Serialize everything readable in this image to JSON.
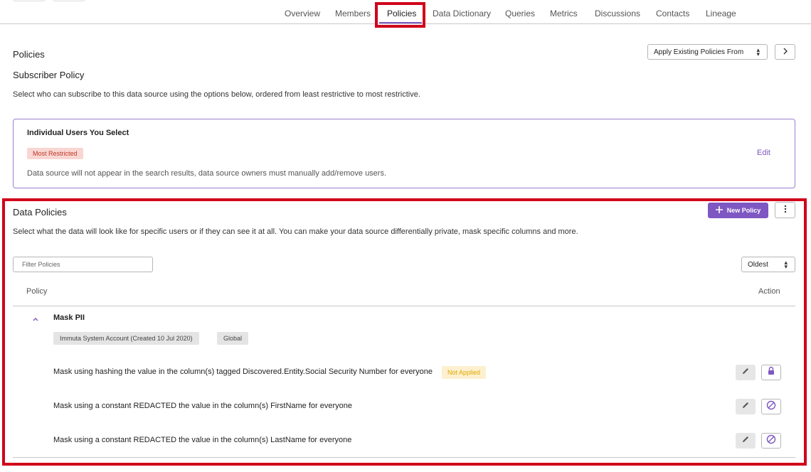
{
  "nav": {
    "tabs": [
      {
        "label": "Overview"
      },
      {
        "label": "Members"
      },
      {
        "label": "Policies"
      },
      {
        "label": "Data Dictionary"
      },
      {
        "label": "Queries"
      },
      {
        "label": "Metrics"
      },
      {
        "label": "Discussions"
      },
      {
        "label": "Contacts"
      },
      {
        "label": "Lineage"
      }
    ],
    "active_tab": "Policies"
  },
  "policies": {
    "title": "Policies",
    "apply_existing_label": "Apply Existing Policies From"
  },
  "subscriber_policy": {
    "title": "Subscriber Policy",
    "description": "Select who can subscribe to this data source using the options below, ordered from least restrictive to most restrictive.",
    "card": {
      "title": "Individual Users You Select",
      "badge": "Most Restricted",
      "edit_label": "Edit",
      "note": "Data source will not appear in the search results, data source owners must manually add/remove users."
    }
  },
  "data_policies": {
    "title": "Data Policies",
    "new_policy_label": "New Policy",
    "description": "Select what the data will look like for specific users or if they can see it at all. You can make your data source differentially private, mask specific columns and more.",
    "filter_placeholder": "Filter Policies",
    "sort_value": "Oldest",
    "columns": {
      "policy": "Policy",
      "action": "Action"
    },
    "group": {
      "name": "Mask PII",
      "chips": [
        "Immuta System Account (Created 10 Jul 2020)",
        "Global"
      ],
      "rules": [
        {
          "text": "Mask using hashing the value in the column(s) tagged Discovered.Entity.Social Security Number for everyone",
          "status": "Not Applied",
          "action_icon": "lock-icon"
        },
        {
          "text": "Mask using a constant REDACTED the value in the column(s) FirstName for everyone",
          "status": "",
          "action_icon": "disable-icon"
        },
        {
          "text": "Mask using a constant REDACTED the value in the column(s) LastName for everyone",
          "status": "",
          "action_icon": "disable-icon"
        }
      ]
    }
  },
  "colors": {
    "accent": "#7e57c2",
    "highlight": "#d0021b",
    "badge_restricted_bg": "#f9d6d2",
    "badge_restricted_text": "#c0392b",
    "not_applied_bg": "#fdf0cf",
    "not_applied_text": "#e0a800"
  }
}
